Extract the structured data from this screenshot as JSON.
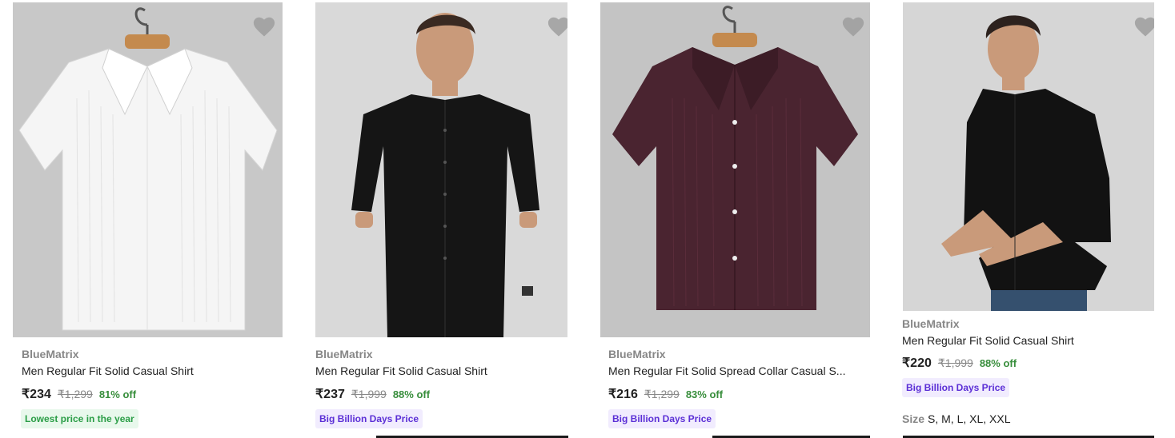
{
  "colors": {
    "accent_green": "#388e3c",
    "badge_purple": "#5b2fd6",
    "badge_green": "#2a9d46",
    "muted": "#878787"
  },
  "products": [
    {
      "brand": "BlueMatrix",
      "title": "Men Regular Fit Solid Casual Shirt",
      "price": "₹234",
      "mrp": "₹1,299",
      "discount": "81% off",
      "badge": "Lowest price in the year",
      "shirt": "white-half-sleeve-shirt"
    },
    {
      "brand": "BlueMatrix",
      "title": "Men Regular Fit Solid Casual Shirt",
      "price": "₹237",
      "mrp": "₹1,999",
      "discount": "88% off",
      "badge": "Big Billion Days Price",
      "shirt": "black-shirt-model"
    },
    {
      "brand": "BlueMatrix",
      "title": "Men Regular Fit Solid Spread Collar Casual S...",
      "price": "₹216",
      "mrp": "₹1,299",
      "discount": "83% off",
      "badge": "Big Billion Days Price",
      "shirt": "maroon-half-sleeve-shirt"
    },
    {
      "brand": "BlueMatrix",
      "title": "Men Regular Fit Solid Casual Shirt",
      "price": "₹220",
      "mrp": "₹1,999",
      "discount": "88% off",
      "badge": "Big Billion Days Price",
      "size_label": "Size",
      "sizes": "S, M, L, XL, XXL",
      "shirt": "black-shirt-model"
    }
  ],
  "icons": {
    "wishlist": "heart-icon"
  }
}
